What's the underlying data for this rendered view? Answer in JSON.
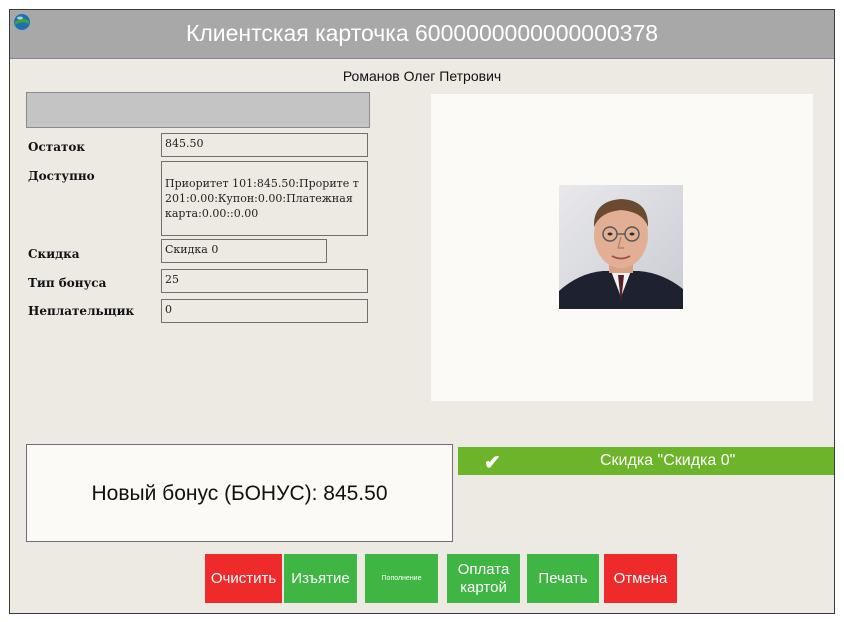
{
  "window": {
    "title": "Клиентская карточка 6000000000000000378",
    "logo_icon": "globe-logo-icon",
    "client_name": "Романов Олег Петрович"
  },
  "fields": {
    "balance": {
      "label": "Остаток",
      "value": "845.50"
    },
    "available": {
      "label": "Доступно",
      "value": "Приоритет 101:845.50:Прорите т 201:0.00:Купон:0.00:Платежная карта:0.00::0.00"
    },
    "discount": {
      "label": "Скидка",
      "value": "Скидка 0"
    },
    "bonus_type": {
      "label": "Тип бонуса",
      "value": "25"
    },
    "non_payer": {
      "label": "Неплательщик",
      "value": "0"
    }
  },
  "bonus": {
    "text": "Новый бонус (БОНУС): 845.50"
  },
  "discount_status": {
    "text": "Скидка \"Скидка 0\"",
    "icon": "checkmark-icon"
  },
  "buttons": {
    "clear": "Очистить",
    "withdraw": "Изъятие",
    "topup": "Пополнение",
    "card_pay_line1": "Оплата",
    "card_pay_line2": "картой",
    "print": "Печать",
    "cancel": "Отмена"
  },
  "colors": {
    "titlebar": "#a8a8a8",
    "background": "#edeae3",
    "accent_green": "#6cb52a",
    "button_green": "#3fb544",
    "button_red": "#ee2a2a"
  }
}
